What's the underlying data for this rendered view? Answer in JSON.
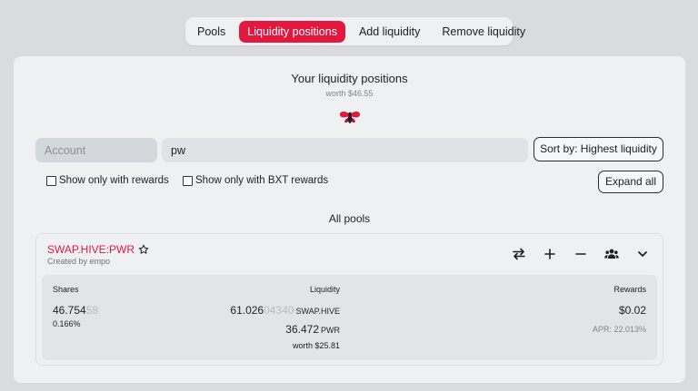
{
  "tabs": [
    {
      "label": "Pools",
      "active": false
    },
    {
      "label": "Liquidity positions",
      "active": true
    },
    {
      "label": "Add liquidity",
      "active": false
    },
    {
      "label": "Remove liquidity",
      "active": false
    }
  ],
  "header": {
    "title": "Your liquidity positions",
    "worth": "worth $46.55"
  },
  "filters": {
    "account_placeholder": "Account",
    "search_value": "pw",
    "sort_label": "Sort by: Highest liquidity",
    "checkbox_rewards": "Show only with rewards",
    "checkbox_bxt": "Show only with BXT rewards",
    "expand_label": "Expand all"
  },
  "section_label": "All pools",
  "pool": {
    "name": "SWAP.HIVE:PWR",
    "created": "Created by empo",
    "actions": [
      "swap-icon",
      "plus-icon",
      "minus-icon",
      "users-icon",
      "chevron-down-icon"
    ],
    "shares_label": "Shares",
    "shares_main": "46.754",
    "shares_faint": "58",
    "shares_pct": "0.166%",
    "liquidity_label": "Liquidity",
    "liq1_main": "61.026",
    "liq1_faint": "04340",
    "liq1_token": "SWAP.HIVE",
    "liq2_main": "36.472",
    "liq2_token": "PWR",
    "liq_worth": "worth $25.81",
    "rewards_label": "Rewards",
    "rewards_value": "$0.02",
    "apr": "APR: 22.013%"
  },
  "colors": {
    "accent": "#e3183f",
    "background": "#d9dbde",
    "card": "#eff0f2"
  }
}
